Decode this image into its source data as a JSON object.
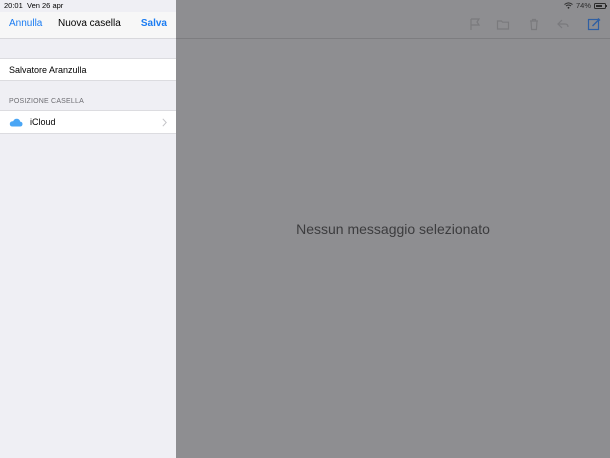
{
  "status_bar": {
    "time": "20:01",
    "date": "Ven 26 apr",
    "battery": "74%",
    "battery_level": 0.74,
    "icons": [
      "wifi-icon",
      "battery-icon"
    ]
  },
  "sheet": {
    "nav": {
      "cancel_label": "Annulla",
      "title": "Nuova casella",
      "save_label": "Salva"
    },
    "name_field": {
      "value": "Salvatore Aranzulla"
    },
    "location_section": {
      "header": "POSIZIONE CASELLA",
      "item_label": "iCloud",
      "item_icon": "icloud-icon",
      "chevron_icon": "chevron-right-icon"
    }
  },
  "detail": {
    "empty_message": "Nessun messaggio selezionato",
    "toolbar_icons": [
      "flag-icon",
      "folder-icon",
      "trash-icon",
      "reply-icon",
      "compose-icon"
    ]
  },
  "colors": {
    "accent": "#1a7cf2",
    "dim_overlay": "#8e8e91",
    "sheet_background": "#efeff4",
    "cloud": "#4aa6f5"
  }
}
